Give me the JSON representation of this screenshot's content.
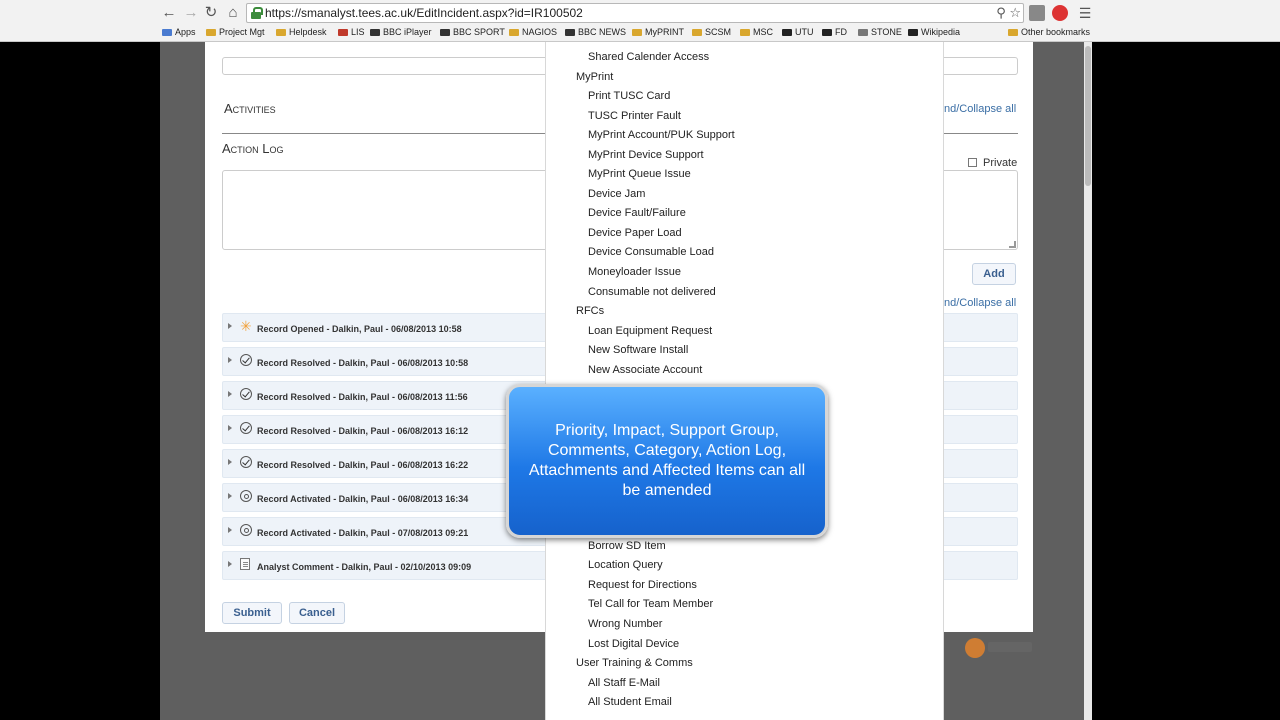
{
  "browser": {
    "url": "https://smanalyst.tees.ac.uk/EditIncident.aspx?id=IR100502",
    "bookmarks": [
      "Apps",
      "Project Mgt",
      "Helpdesk",
      "LIS",
      "BBC iPlayer",
      "BBC SPORT",
      "NAGIOS",
      "BBC NEWS",
      "MyPRINT",
      "SCSM",
      "MSC",
      "UTU",
      "FD",
      "STONE",
      "Wikipedia"
    ],
    "other_bookmarks": "Other bookmarks"
  },
  "form": {
    "activities_heading": "Activities",
    "action_log_heading": "Action Log",
    "expand_collapse_label": "nd/Collapse all",
    "private_label": "Private",
    "add_label": "Add",
    "submit_label": "Submit",
    "cancel_label": "Cancel"
  },
  "log_entries": [
    {
      "icon": "star-icon",
      "text": "Record Opened - Dalkin, Paul - 06/08/2013 10:58"
    },
    {
      "icon": "check-icon",
      "text": "Record Resolved - Dalkin, Paul - 06/08/2013 10:58"
    },
    {
      "icon": "check-icon",
      "text": "Record Resolved - Dalkin, Paul - 06/08/2013 11:56"
    },
    {
      "icon": "check-icon",
      "text": "Record Resolved - Dalkin, Paul - 06/08/2013 16:12"
    },
    {
      "icon": "check-icon",
      "text": "Record Resolved - Dalkin, Paul - 06/08/2013 16:22"
    },
    {
      "icon": "reload-icon",
      "text": "Record Activated - Dalkin, Paul - 06/08/2013 16:34"
    },
    {
      "icon": "reload-icon",
      "text": "Record Activated - Dalkin, Paul - 07/08/2013 09:21"
    },
    {
      "icon": "document-icon",
      "text": "Analyst Comment - Dalkin, Paul - 02/10/2013 09:09"
    }
  ],
  "dropdown": {
    "options_top": [
      {
        "kind": "item",
        "label": "Shared Calender Access"
      },
      {
        "kind": "group",
        "label": "MyPrint"
      },
      {
        "kind": "item",
        "label": "Print TUSC Card"
      },
      {
        "kind": "item",
        "label": "TUSC Printer Fault"
      },
      {
        "kind": "item",
        "label": "MyPrint Account/PUK Support"
      },
      {
        "kind": "item",
        "label": "MyPrint Device Support"
      },
      {
        "kind": "item",
        "label": "MyPrint Queue Issue"
      },
      {
        "kind": "item",
        "label": "Device Jam"
      },
      {
        "kind": "item",
        "label": "Device Fault/Failure"
      },
      {
        "kind": "item",
        "label": "Device Paper Load"
      },
      {
        "kind": "item",
        "label": "Device Consumable Load"
      },
      {
        "kind": "item",
        "label": "Moneyloader Issue"
      },
      {
        "kind": "item",
        "label": "Consumable not delivered"
      },
      {
        "kind": "group",
        "label": "RFCs"
      },
      {
        "kind": "item",
        "label": "Loan Equipment Request"
      },
      {
        "kind": "item",
        "label": "New Software Install"
      },
      {
        "kind": "item",
        "label": "New Associate Account"
      }
    ],
    "options_bottom": [
      {
        "kind": "item",
        "label": "Borrow SD Item"
      },
      {
        "kind": "item",
        "label": "Location Query"
      },
      {
        "kind": "item",
        "label": "Request for Directions"
      },
      {
        "kind": "item",
        "label": "Tel Call for Team Member"
      },
      {
        "kind": "item",
        "label": "Wrong Number"
      },
      {
        "kind": "item",
        "label": "Lost Digital Device"
      },
      {
        "kind": "group",
        "label": "User Training & Comms"
      },
      {
        "kind": "item",
        "label": "All Staff E-Mail"
      },
      {
        "kind": "item",
        "label": "All Student Email"
      }
    ]
  },
  "callout": {
    "text": "Priority, Impact, Support Group, Comments, Category, Action Log, Attachments and Affected Items can all be amended"
  }
}
